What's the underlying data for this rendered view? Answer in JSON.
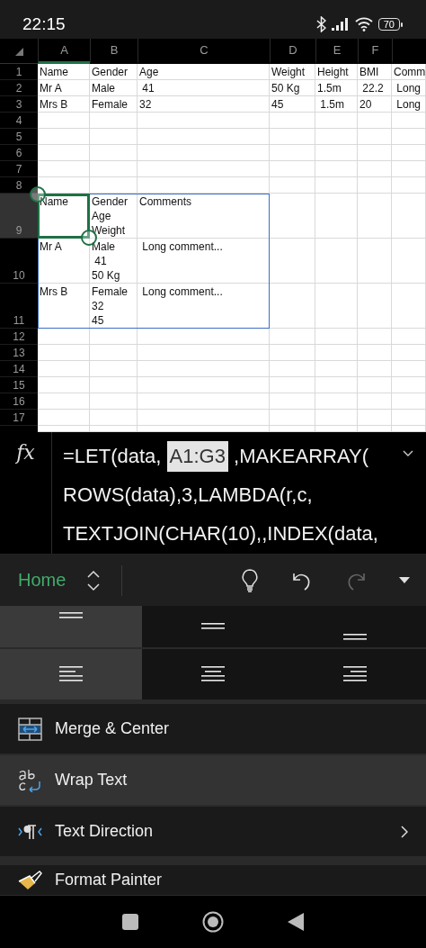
{
  "status_bar": {
    "time": "22:15",
    "battery": "70"
  },
  "sheet": {
    "columns": [
      {
        "letter": "A",
        "selected": true
      },
      {
        "letter": "B",
        "selected": false
      },
      {
        "letter": "C",
        "selected": false
      },
      {
        "letter": "D",
        "selected": false
      },
      {
        "letter": "E",
        "selected": false
      },
      {
        "letter": "F",
        "selected": false
      },
      {
        "selected": false
      }
    ],
    "rows": [
      {
        "number": "1",
        "selected": false,
        "cells": [
          "Name",
          "Gender",
          "Age",
          "Weight",
          "Height",
          "BMI",
          "Comm"
        ]
      },
      {
        "number": "2",
        "selected": false,
        "cells": [
          "Mr A",
          "Male",
          " 41",
          "50 Kg",
          "1.5m",
          " 22.2",
          " Long"
        ]
      },
      {
        "number": "3",
        "selected": false,
        "cells": [
          "Mrs B",
          "Female",
          "32",
          "45",
          " 1.5m",
          "20",
          " Long"
        ]
      },
      {
        "number": "4",
        "selected": false,
        "cells": []
      },
      {
        "number": "5",
        "selected": false,
        "cells": []
      },
      {
        "number": "6",
        "selected": false,
        "cells": []
      },
      {
        "number": "7",
        "selected": false,
        "cells": []
      },
      {
        "number": "8",
        "selected": false,
        "cells": []
      },
      {
        "number": "9",
        "selected": true,
        "active": true,
        "spill": true,
        "cells": [
          "Name",
          "Gender\nAge\nWeight",
          "Comments"
        ]
      },
      {
        "number": "10",
        "selected": false,
        "spill": true,
        "cells": [
          "Mr A",
          "Male\n 41\n50 Kg",
          " Long comment..."
        ]
      },
      {
        "number": "11",
        "selected": false,
        "spill": true,
        "cells": [
          "Mrs B",
          "Female\n32\n45",
          " Long comment..."
        ]
      },
      {
        "number": "12",
        "selected": false,
        "cells": []
      },
      {
        "number": "13",
        "selected": false,
        "cells": []
      },
      {
        "number": "14",
        "selected": false,
        "cells": []
      },
      {
        "number": "15",
        "selected": false,
        "cells": []
      },
      {
        "number": "16",
        "selected": false,
        "cells": []
      },
      {
        "number": "17",
        "selected": false,
        "cells": []
      }
    ]
  },
  "formula_bar": {
    "label": "fx",
    "lines": [
      [
        {
          "text": "=LET(data, ",
          "highlight": false
        },
        {
          "text": "A1:G3",
          "highlight": true
        },
        {
          "text": " ,MAKEARRAY(",
          "highlight": false
        }
      ],
      [
        {
          "text": "ROWS(data),3,LAMBDA(r,c,",
          "highlight": false
        }
      ],
      [
        {
          "text": "TEXTJOIN(CHAR(10),,INDEX(data,",
          "highlight": false
        }
      ]
    ]
  },
  "ribbon": {
    "tab": "Home",
    "tools": [
      {
        "kind": "ideas",
        "disabled": false
      },
      {
        "kind": "undo",
        "disabled": false
      },
      {
        "kind": "redo",
        "disabled": true
      },
      {
        "kind": "more",
        "disabled": false
      }
    ]
  },
  "alignment": [
    [
      {
        "kind": "top",
        "selected": true
      },
      {
        "kind": "middle",
        "selected": false
      },
      {
        "kind": "bottom",
        "selected": false
      }
    ],
    [
      {
        "kind": "left",
        "selected": true
      },
      {
        "kind": "center",
        "selected": false
      },
      {
        "kind": "right",
        "selected": false
      }
    ]
  ],
  "menu": [
    {
      "kind": "merge",
      "label": "Merge & Center",
      "selected": false,
      "submenu": false
    },
    {
      "kind": "wrap",
      "label": "Wrap Text",
      "selected": true,
      "submenu": false
    },
    {
      "kind": "direction",
      "label": "Text Direction",
      "selected": false,
      "submenu": true
    },
    {
      "kind": "painter",
      "label": "Format Painter",
      "selected": false,
      "submenu": false
    }
  ]
}
